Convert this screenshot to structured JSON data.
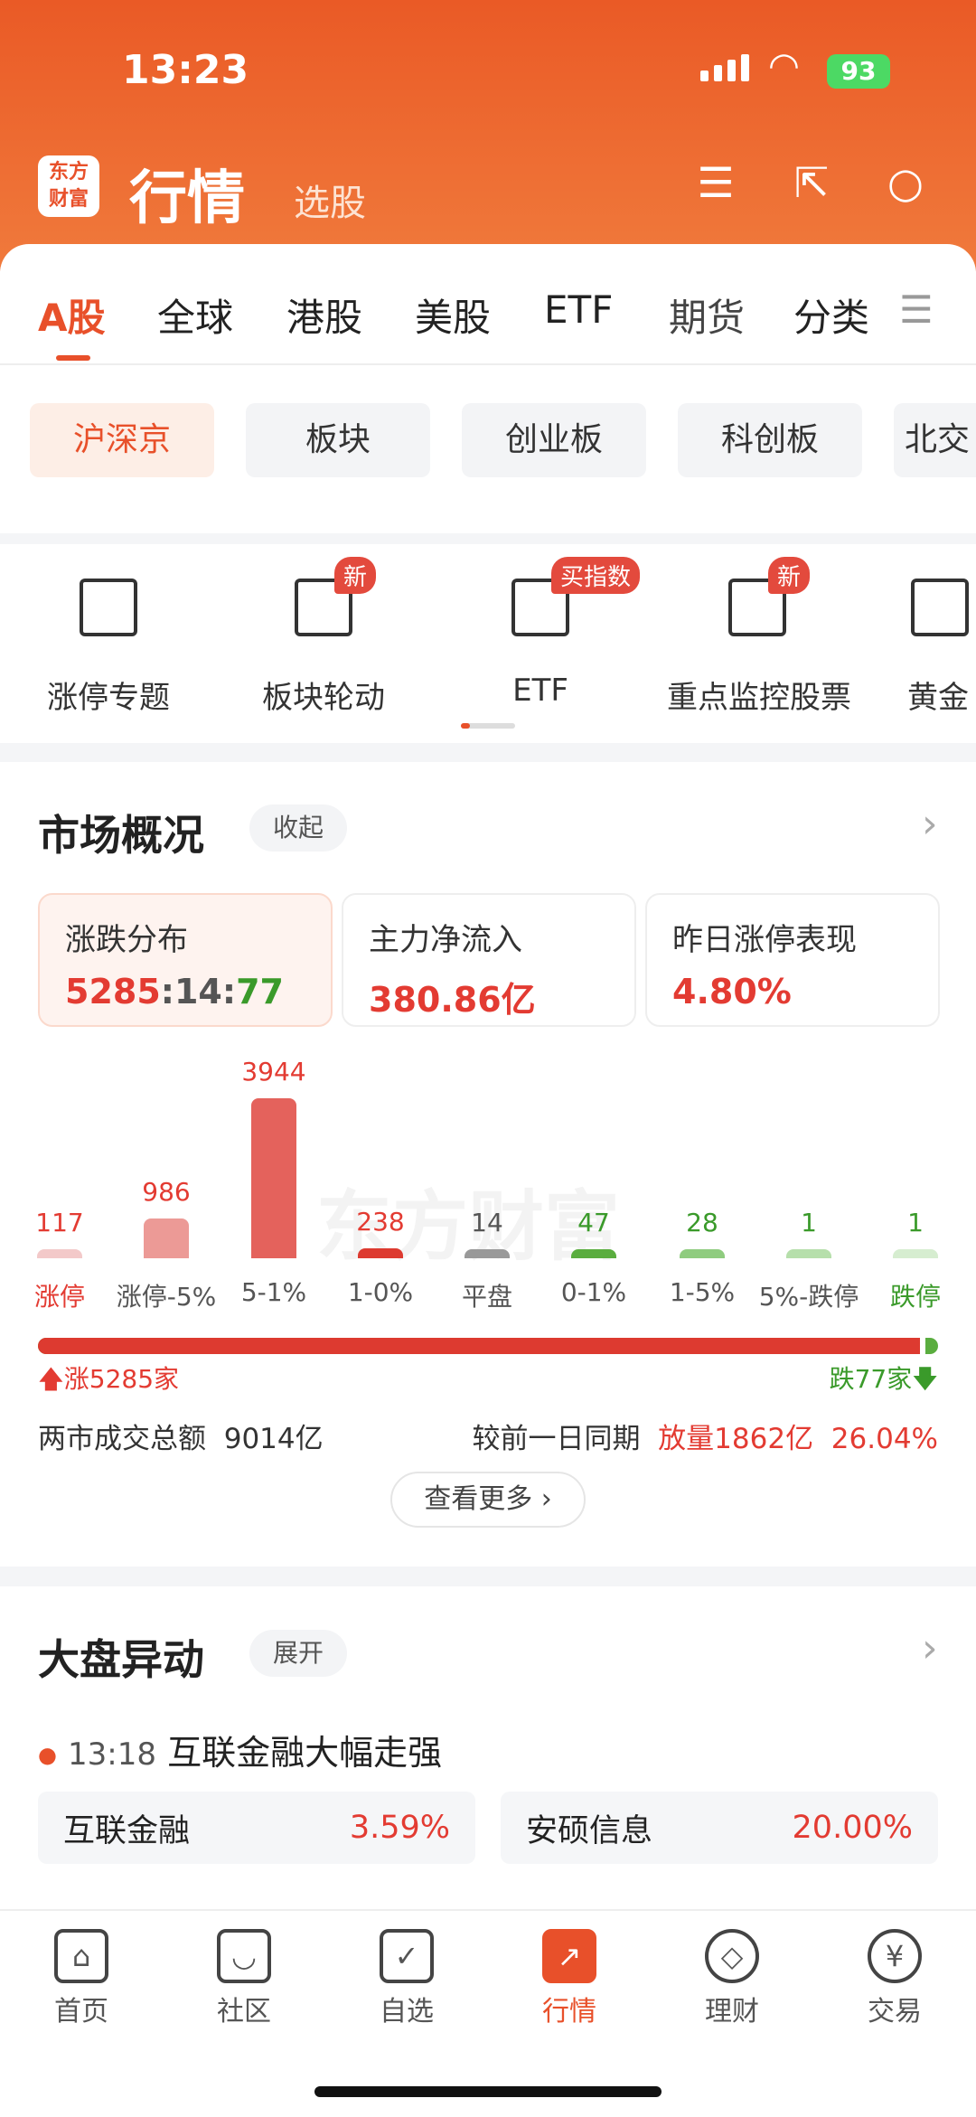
{
  "status": {
    "time": "13:23",
    "battery": "93"
  },
  "header": {
    "logo": "东方财富",
    "title": "行情",
    "subtitle": "选股",
    "icons": [
      "settings-list-icon",
      "share-icon",
      "search-icon"
    ]
  },
  "tabs": [
    {
      "label": "A股",
      "active": true
    },
    {
      "label": "全球"
    },
    {
      "label": "港股"
    },
    {
      "label": "美股"
    },
    {
      "label": "ETF"
    },
    {
      "label": "期货"
    },
    {
      "label": "分类"
    }
  ],
  "chips": [
    {
      "label": "沪深京",
      "active": true
    },
    {
      "label": "板块"
    },
    {
      "label": "创业板"
    },
    {
      "label": "科创板"
    },
    {
      "label": "北交"
    }
  ],
  "quick": [
    {
      "label": "涨停专题"
    },
    {
      "label": "板块轮动",
      "badge": "新"
    },
    {
      "label": "ETF",
      "badge": "买指数"
    },
    {
      "label": "重点监控股票",
      "badge": "新"
    },
    {
      "label": "黄金"
    }
  ],
  "market": {
    "title": "市场概况",
    "toggle": "收起",
    "cards": [
      {
        "title": "涨跌分布",
        "up": "5285",
        "flat": "14",
        "down": "77",
        "sep": ":"
      },
      {
        "title": "主力净流入",
        "value": "380.86亿"
      },
      {
        "title": "昨日涨停表现",
        "value": "4.80%"
      }
    ],
    "watermark": "东方财富",
    "up_label": "涨5285家",
    "down_label": "跌77家",
    "total_label": "两市成交总额",
    "total_value": "9014亿",
    "compare_label": "较前一日同期",
    "compare_value": "放量1862亿",
    "compare_pct": "26.04%",
    "more": "查看更多 ›"
  },
  "chart_data": {
    "type": "bar",
    "categories": [
      "涨停",
      "涨停-5%",
      "5-1%",
      "1-0%",
      "平盘",
      "0-1%",
      "1-5%",
      "5%-跌停",
      "跌停"
    ],
    "values": [
      117,
      986,
      3944,
      238,
      14,
      47,
      28,
      1,
      1
    ],
    "colors": [
      "#f3c9c9",
      "#ec9a96",
      "#e4625c",
      "#dd3a30",
      "#999999",
      "#5aad3f",
      "#8fcc7f",
      "#b6dfab",
      "#d6edd0"
    ],
    "label_colors": [
      "#e33b32",
      "#e33b32",
      "#e33b32",
      "#e33b32",
      "#555555",
      "#3a9a2a",
      "#3a9a2a",
      "#3a9a2a",
      "#3a9a2a"
    ],
    "up_down_ratio": {
      "up": 5285,
      "down": 77
    }
  },
  "movers": {
    "title": "大盘异动",
    "toggle": "展开",
    "news_time": "13:18",
    "news_text": "互联金融大幅走强",
    "stocks": [
      {
        "name": "互联金融",
        "pct": "3.59%"
      },
      {
        "name": "安硕信息",
        "pct": "20.00%"
      }
    ]
  },
  "nav": [
    {
      "label": "首页",
      "icon": "home-icon",
      "glyph": "⌂"
    },
    {
      "label": "社区",
      "icon": "chat-icon",
      "glyph": "◡"
    },
    {
      "label": "自选",
      "icon": "watchlist-icon",
      "glyph": "✓"
    },
    {
      "label": "行情",
      "icon": "market-icon",
      "glyph": "↗",
      "active": true
    },
    {
      "label": "理财",
      "icon": "wealth-icon",
      "glyph": "◇"
    },
    {
      "label": "交易",
      "icon": "yuan-icon",
      "glyph": "¥"
    }
  ]
}
